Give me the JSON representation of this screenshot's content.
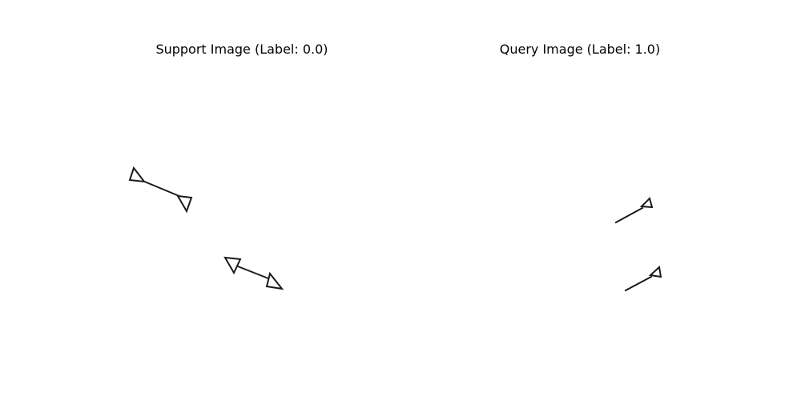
{
  "panels": {
    "support": {
      "title": "Support Image (Label: 0.0)"
    },
    "query": {
      "title": "Query Image (Label: 1.0)"
    }
  }
}
